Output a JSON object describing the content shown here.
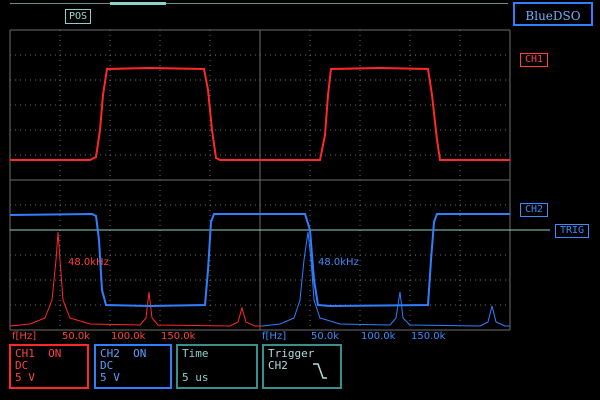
{
  "header": {
    "pos_label": "POS",
    "brand": "BlueDSO"
  },
  "markers": {
    "ch1": "CH1",
    "ch2": "CH2",
    "trig": "TRIG"
  },
  "fft": {
    "ch1_freq": "48.0kHz",
    "ch2_freq": "48.0kHz",
    "ch1_axis": [
      "f[Hz]",
      "50.0k",
      "100.0k",
      "150.0k"
    ],
    "ch2_axis": [
      "f[Hz]",
      "50.0k",
      "100.0k",
      "150.0k"
    ]
  },
  "panels": {
    "ch1": {
      "name": "CH1",
      "state": "ON",
      "coupling": "DC",
      "scale": "5 V"
    },
    "ch2": {
      "name": "CH2",
      "state": "ON",
      "coupling": "DC",
      "scale": "5 V"
    },
    "time": {
      "title": "Time",
      "value": "5 us"
    },
    "trigger": {
      "title": "Trigger",
      "source": "CH2",
      "edge_icon": "falling-edge-icon"
    }
  },
  "colors": {
    "ch1": "#ff2828",
    "ch2": "#2f7fff",
    "grid": "#6e6e6e",
    "accent": "#8fd0cc"
  }
}
